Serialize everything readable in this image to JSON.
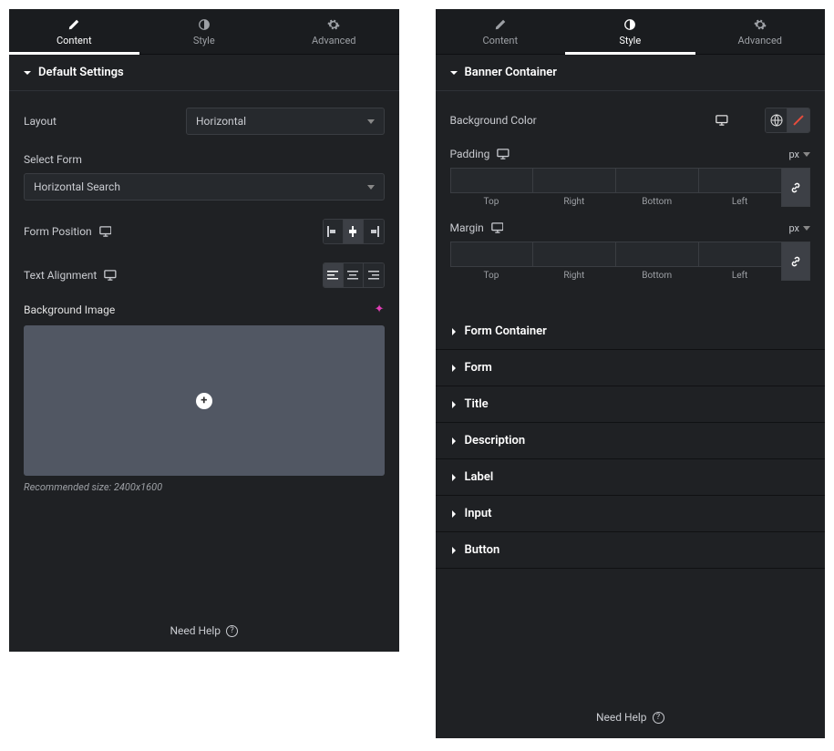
{
  "tabs": {
    "content": "Content",
    "style": "Style",
    "advanced": "Advanced"
  },
  "leftPanel": {
    "section": "Default Settings",
    "layout": {
      "label": "Layout",
      "value": "Horizontal"
    },
    "selectForm": {
      "label": "Select Form",
      "value": "Horizontal Search"
    },
    "formPosition": {
      "label": "Form Position",
      "options": [
        "left",
        "center",
        "right"
      ],
      "active": "center"
    },
    "textAlignment": {
      "label": "Text Alignment",
      "options": [
        "left",
        "center",
        "right"
      ],
      "active": "left"
    },
    "bgImage": {
      "label": "Background Image",
      "hint": "Recommended size: 2400x1600"
    }
  },
  "rightPanel": {
    "openSection": "Banner Container",
    "backgroundColor": {
      "label": "Background Color"
    },
    "padding": {
      "label": "Padding",
      "unit": "px",
      "sides": [
        "Top",
        "Right",
        "Bottom",
        "Left"
      ]
    },
    "margin": {
      "label": "Margin",
      "unit": "px",
      "sides": [
        "Top",
        "Right",
        "Bottom",
        "Left"
      ]
    },
    "closedSections": [
      "Form Container",
      "Form",
      "Title",
      "Description",
      "Label",
      "Input",
      "Button"
    ]
  },
  "help": "Need Help"
}
